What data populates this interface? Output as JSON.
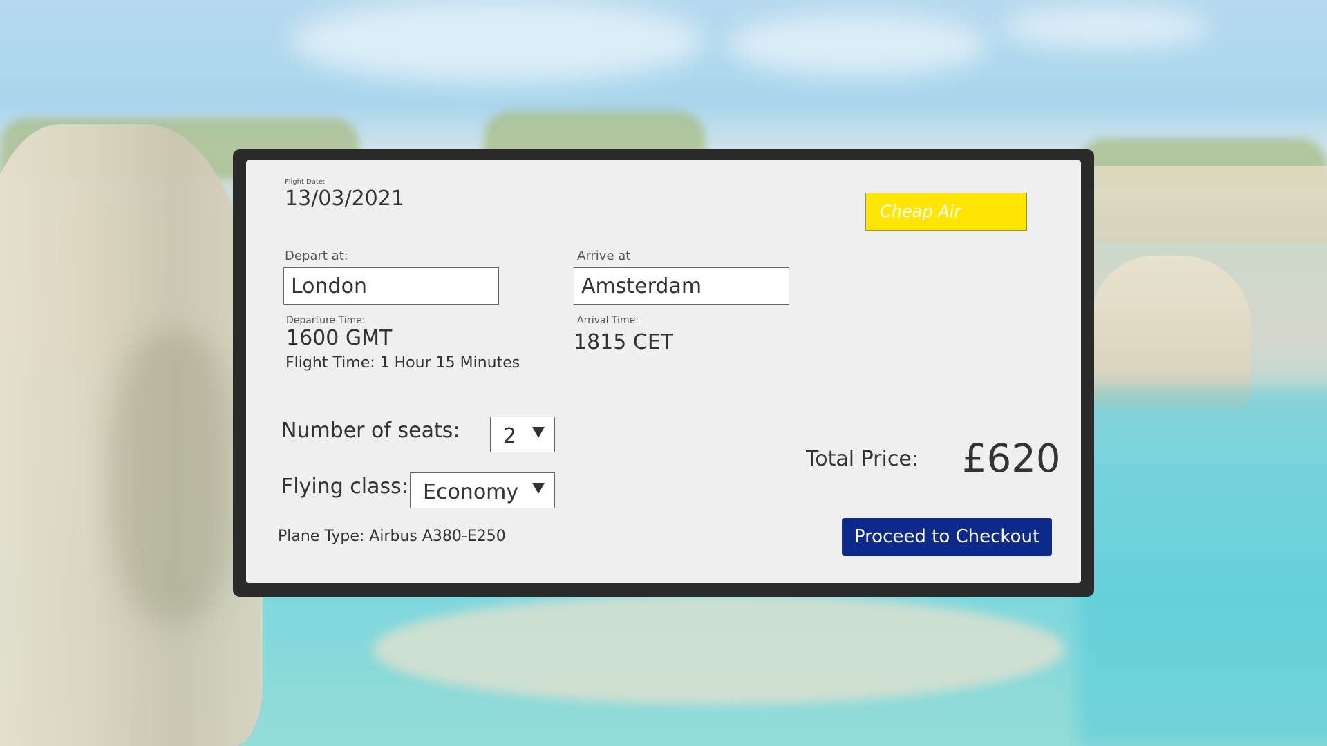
{
  "colors": {
    "brand_bg": "#ffe600",
    "checkout_bg": "#0b2a8a",
    "frame": "#2a2a2a",
    "card": "#efefef"
  },
  "flight_date": {
    "label": "Flight Date:",
    "value": "13/03/2021"
  },
  "brand": {
    "name": "Cheap Air"
  },
  "depart": {
    "label": "Depart at:",
    "value": "London",
    "time_label": "Departure Time:",
    "time_value": "1600 GMT"
  },
  "arrive": {
    "label": "Arrive at",
    "value": "Amsterdam",
    "time_label": "Arrival Time:",
    "time_value": "1815 CET"
  },
  "flight_time": "Flight Time: 1 Hour 15 Minutes",
  "seats": {
    "label": "Number of seats:",
    "value": "2"
  },
  "flying_class": {
    "label": "Flying class:",
    "value": "Economy"
  },
  "plane_type": "Plane Type: Airbus A380-E250",
  "total_price": {
    "label": "Total Price:",
    "value": "£620"
  },
  "checkout": {
    "label": "Proceed to Checkout"
  }
}
